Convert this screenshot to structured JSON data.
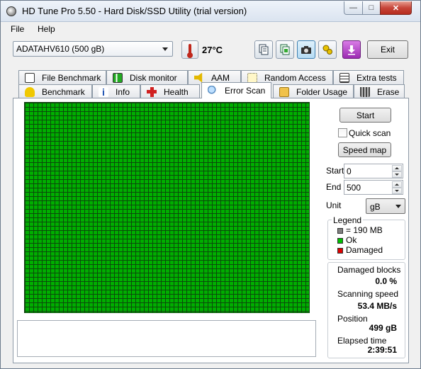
{
  "window": {
    "title": "HD Tune Pro 5.50 - Hard Disk/SSD Utility (trial version)",
    "min_glyph": "—",
    "max_glyph": "□",
    "close_glyph": "✕"
  },
  "menu": {
    "file": "File",
    "help": "Help"
  },
  "toolbar": {
    "drive": "ADATAHV610 (500 gB)",
    "temperature": "27°C",
    "exit_label": "Exit",
    "icons": [
      "copy-icon",
      "copy-all-icon",
      "screenshot-camera-icon",
      "options-icon",
      "save-download-icon"
    ]
  },
  "tabs": {
    "row1": [
      "File Benchmark",
      "Disk monitor",
      "AAM",
      "Random Access",
      "Extra tests"
    ],
    "row2": [
      "Benchmark",
      "Info",
      "Health",
      "Error Scan",
      "Folder Usage",
      "Erase"
    ],
    "selected": "Error Scan"
  },
  "controls": {
    "start_button": "Start",
    "quick_scan_label": "Quick scan",
    "quick_scan_checked": false,
    "speed_map_button": "Speed map",
    "start_label": "Start",
    "start_value": "0",
    "end_label": "End",
    "end_value": "500",
    "unit_label": "Unit",
    "unit_value": "gB"
  },
  "legend": {
    "title": "Legend",
    "block_size": "= 190 MB",
    "ok": "Ok",
    "damaged": "Damaged",
    "colors": {
      "block": "#808080",
      "ok": "#00c000",
      "damaged": "#e00000"
    }
  },
  "stats": {
    "damaged_blocks_label": "Damaged blocks",
    "damaged_blocks_value": "0.0 %",
    "scanning_speed_label": "Scanning speed",
    "scanning_speed_value": "53.4 MB/s",
    "position_label": "Position",
    "position_value": "499 gB",
    "elapsed_time_label": "Elapsed time",
    "elapsed_time_value": "2:39:51"
  },
  "scan_grid": {
    "ok_color": "#00ae00",
    "grid_line_color": "#0b4a0b",
    "damaged_blocks": 0
  }
}
